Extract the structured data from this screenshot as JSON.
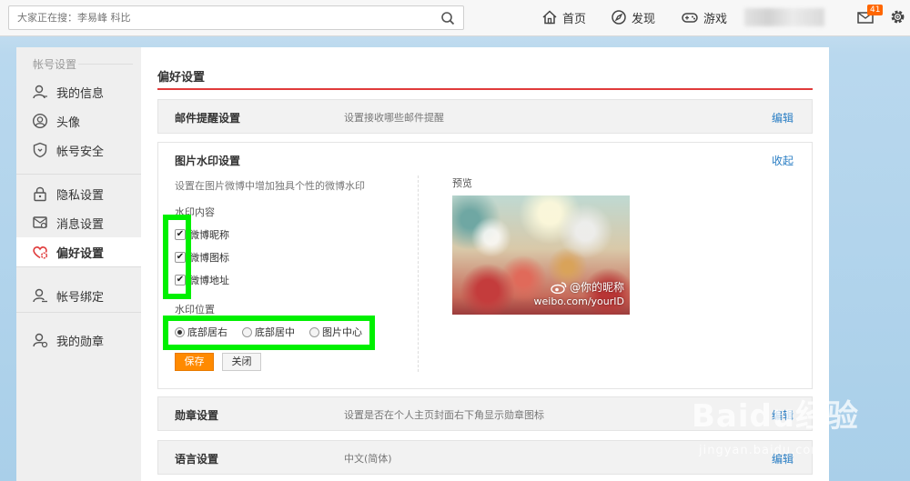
{
  "search": {
    "placeholder": "大家正在搜：李易峰 科比"
  },
  "nav": {
    "home": "首页",
    "discover": "发现",
    "game": "游戏",
    "mail_badge": "41"
  },
  "sidebar": {
    "title": "帐号设置",
    "items": [
      {
        "label": "我的信息",
        "icon": "user-icon"
      },
      {
        "label": "头像",
        "icon": "avatar-icon"
      },
      {
        "label": "帐号安全",
        "icon": "shield-icon"
      },
      {
        "label": "隐私设置",
        "icon": "lock-icon"
      },
      {
        "label": "消息设置",
        "icon": "message-icon"
      },
      {
        "label": "偏好设置",
        "icon": "heart-gear-icon",
        "active": true
      },
      {
        "label": "帐号绑定",
        "icon": "user-link-icon"
      },
      {
        "label": "我的勋章",
        "icon": "medal-user-icon"
      }
    ]
  },
  "main": {
    "title": "偏好设置",
    "rows": {
      "mail": {
        "title": "邮件提醒设置",
        "desc": "设置接收哪些邮件提醒",
        "action": "编辑"
      },
      "medal": {
        "title": "勋章设置",
        "desc": "设置是否在个人主页封面右下角显示勋章图标",
        "action": "编辑"
      },
      "language": {
        "title": "语言设置",
        "desc": "中文(简体)",
        "action": "编辑"
      }
    },
    "watermark": {
      "title": "图片水印设置",
      "collapse": "收起",
      "desc": "设置在图片微博中增加独具个性的微博水印",
      "content_label": "水印内容",
      "options": [
        {
          "label": "微博昵称",
          "checked": true
        },
        {
          "label": "微博图标",
          "checked": true
        },
        {
          "label": "微博地址",
          "checked": true
        }
      ],
      "position_label": "水印位置",
      "positions": [
        {
          "label": "底部居右",
          "selected": true
        },
        {
          "label": "底部居中",
          "selected": false
        },
        {
          "label": "图片中心",
          "selected": false
        }
      ],
      "save": "保存",
      "close": "关闭",
      "preview_label": "预览",
      "preview_name": "@你的昵称",
      "preview_url": "weibo.com/yourID"
    }
  },
  "watermark_brand": {
    "logo": "Baidu经验",
    "sub": "jingyan.baidu.com"
  },
  "colors": {
    "accent_red": "#e03b3b",
    "link": "#2a7ec4",
    "save": "#ff8a00",
    "highlight": "#00f000"
  }
}
